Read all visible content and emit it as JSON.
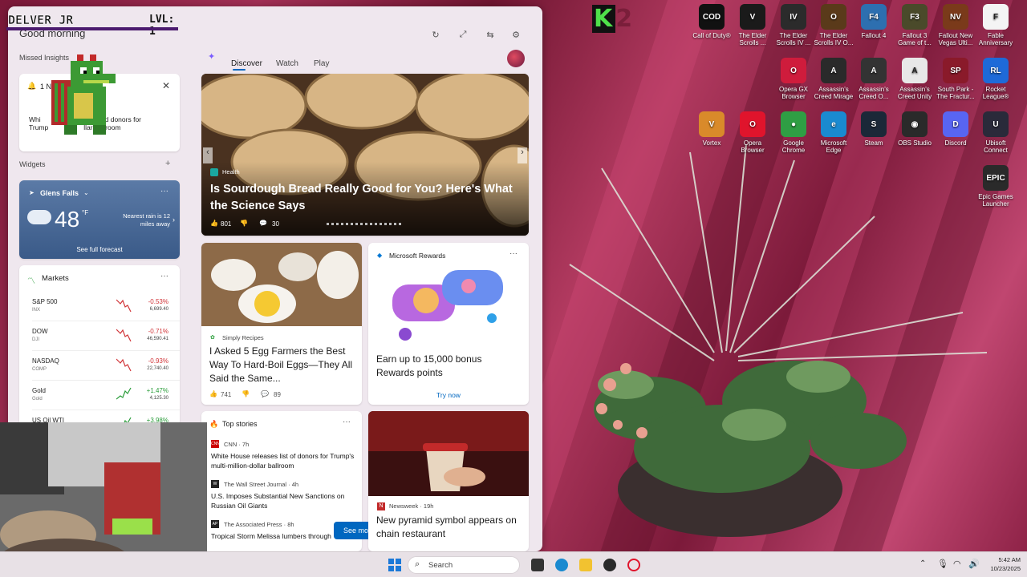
{
  "overlay": {
    "player": "DELVER JR",
    "level": "LVL: 1",
    "k_logo": "K",
    "k_num": "2"
  },
  "panel": {
    "greeting": "Good morning",
    "missed_title": "Missed Insights",
    "notif_label": "1 Notifi",
    "notif_text1": "Whi",
    "notif_text1b": "d donors for",
    "notif_text2": "Trump",
    "notif_text2b": "llar ballroom",
    "widgets_title": "Widgets",
    "tabs": [
      "Discover",
      "Watch",
      "Play"
    ]
  },
  "weather": {
    "location": "Glens Falls",
    "temp": "48",
    "unit": "°F",
    "rain": "Nearest rain is 12 miles away",
    "link": "See full forecast"
  },
  "markets": {
    "title": "Markets",
    "rows": [
      {
        "name": "S&P 500",
        "sub": "INX",
        "change": "-0.53%",
        "value": "6,699.40",
        "dir": "down"
      },
      {
        "name": "DOW",
        "sub": "DJI",
        "change": "-0.71%",
        "value": "46,590.41",
        "dir": "down"
      },
      {
        "name": "NASDAQ",
        "sub": "COMP",
        "change": "-0.93%",
        "value": "22,740.40",
        "dir": "down"
      },
      {
        "name": "Gold",
        "sub": "Gold",
        "change": "+1.47%",
        "value": "4,125.30",
        "dir": "up"
      },
      {
        "name": "US Oil WTI",
        "sub": "",
        "change": "+3.98%",
        "value": "",
        "dir": "up"
      }
    ]
  },
  "hero": {
    "source": "Health",
    "title": "Is Sourdough Bread Really Good for You? Here's What the Science Says",
    "likes": "801",
    "comments": "30"
  },
  "egg": {
    "source": "Simply Recipes",
    "title": "I Asked 5 Egg Farmers the Best Way To Hard-Boil Eggs—They All Said the Same...",
    "likes": "741",
    "comments": "89"
  },
  "rewards": {
    "title": "Microsoft Rewards",
    "text": "Earn up to 15,000 bonus Rewards points",
    "cta": "Try now"
  },
  "top_stories": {
    "title": "Top stories",
    "items": [
      {
        "source": "CNN · 7h",
        "headline": "White House releases list of donors for Trump's multi-million-dollar ballroom",
        "badge": "CNN"
      },
      {
        "source": "The Wall Street Journal · 4h",
        "headline": "U.S. Imposes Substantial New Sanctions on Russian Oil Giants",
        "badge": "W"
      },
      {
        "source": "The Associated Press · 8h",
        "headline": "Tropical Storm Melissa lumbers through",
        "badge": "AP"
      }
    ],
    "see_more": "See more"
  },
  "newsweek": {
    "source": "Newsweek · 19h",
    "title": "New pyramid symbol appears on chain restaurant"
  },
  "desktop_icons": [
    {
      "label": "Call of Duty®",
      "color": "#111111",
      "glyph": "COD"
    },
    {
      "label": "The Elder Scrolls ...",
      "color": "#1a1a1a",
      "glyph": "V"
    },
    {
      "label": "The Elder Scrolls IV ...",
      "color": "#2b2b2b",
      "glyph": "IV"
    },
    {
      "label": "The Elder Scrolls IV O...",
      "color": "#5a3a1a",
      "glyph": "O"
    },
    {
      "label": "Fallout 4",
      "color": "#2d6fb0",
      "glyph": "F4"
    },
    {
      "label": "Fallout 3 Game of t...",
      "color": "#4a4a2a",
      "glyph": "F3"
    },
    {
      "label": "Fallout New Vegas Ulti...",
      "color": "#7a3a1a",
      "glyph": "NV"
    },
    {
      "label": "Fable Anniversary",
      "color": "#f4f4f4",
      "glyph": "F"
    },
    {
      "label": "Opera GX Browser",
      "color": "#cf1c3c",
      "glyph": "O"
    },
    {
      "label": "Assassin's Creed Mirage",
      "color": "#2a2a2a",
      "glyph": "A"
    },
    {
      "label": "Assassin's Creed O...",
      "color": "#333333",
      "glyph": "A"
    },
    {
      "label": "Assassin's Creed Unity",
      "color": "#e8e8e8",
      "glyph": "A"
    },
    {
      "label": "South Park - The Fractur...",
      "color": "#8a1a2a",
      "glyph": "SP"
    },
    {
      "label": "Rocket League®",
      "color": "#1e6ad8",
      "glyph": "RL"
    },
    {
      "label": "Vortex",
      "color": "#d98a2a",
      "glyph": "V"
    },
    {
      "label": "Opera Browser",
      "color": "#e0142c",
      "glyph": "O"
    },
    {
      "label": "Google Chrome",
      "color": "#2f9e44",
      "glyph": "●"
    },
    {
      "label": "Microsoft Edge",
      "color": "#1a8ad0",
      "glyph": "e"
    },
    {
      "label": "Steam",
      "color": "#1b2838",
      "glyph": "S"
    },
    {
      "label": "OBS Studio",
      "color": "#2a2a2a",
      "glyph": "◉"
    },
    {
      "label": "Discord",
      "color": "#5865f2",
      "glyph": "D"
    },
    {
      "label": "Ubisoft Connect",
      "color": "#2a2a3a",
      "glyph": "U"
    },
    {
      "label": "Epic Games Launcher",
      "color": "#2a2a2a",
      "glyph": "EPIC"
    }
  ],
  "taskbar": {
    "search": "Search",
    "time": "5:42 AM",
    "date": "10/23/2025"
  }
}
